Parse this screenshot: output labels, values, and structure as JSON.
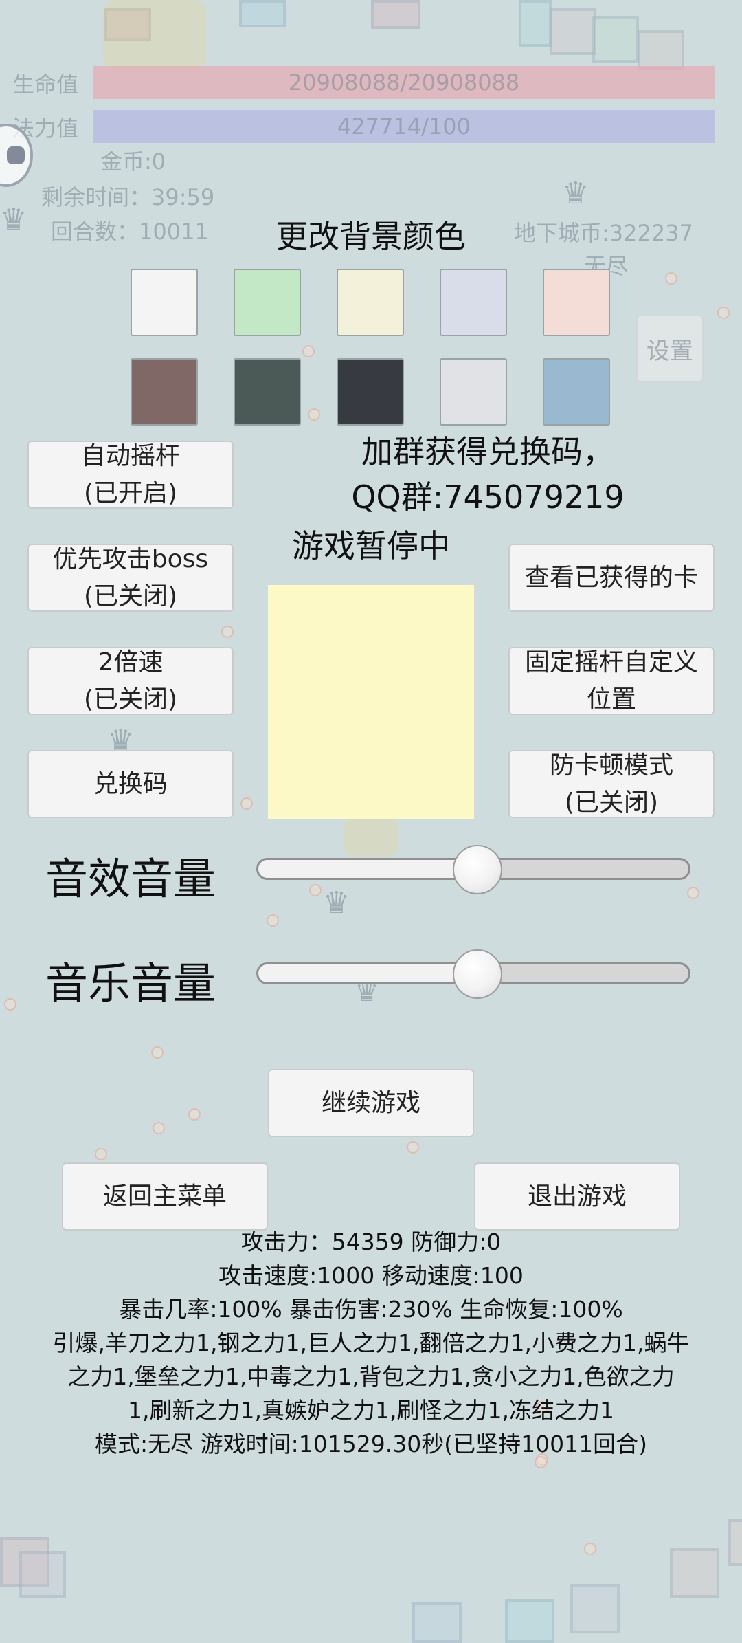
{
  "hud": {
    "hp_label": "生命值",
    "hp_value": "20908088/20908088",
    "mp_label": "法力值",
    "mp_value": "427714/100",
    "gold": "金币:0",
    "time_left": "剩余时间：39:59",
    "rounds": "回合数：10011",
    "dungeon_coins": "地下城币:322237",
    "mode_short": "无尽",
    "settings_label": "设置"
  },
  "bg_color": {
    "title": "更改背景颜色",
    "swatches": [
      "#f4f4f4",
      "#c3e8c6",
      "#f3f1d9",
      "#d8dde9",
      "#f5ddd7",
      "#7f6865",
      "#4c5a57",
      "#373a41",
      "#e1e2e6",
      "#9ab8cf"
    ]
  },
  "promo": {
    "line1": "加群获得兑换码，",
    "line2": "QQ群:745079219"
  },
  "paused_text": "游戏暂停中",
  "left_buttons": [
    {
      "l1": "自动摇杆",
      "l2": "(已开启)"
    },
    {
      "l1": "优先攻击boss",
      "l2": "(已关闭)"
    },
    {
      "l1": "2倍速",
      "l2": "(已关闭)"
    },
    {
      "l1": "兑换码",
      "l2": ""
    }
  ],
  "right_buttons": [
    {
      "l1": "查看已获得的卡",
      "l2": ""
    },
    {
      "l1": "固定摇杆自定义",
      "l2": "位置"
    },
    {
      "l1": "防卡顿模式",
      "l2": "(已关闭)"
    }
  ],
  "sound": {
    "label": "音效音量",
    "value": 0.5
  },
  "music": {
    "label": "音乐音量",
    "value": 0.5
  },
  "actions": {
    "continue": "继续游戏",
    "main_menu": "返回主菜单",
    "quit": "退出游戏"
  },
  "stats": {
    "line1": "攻击力：54359 防御力:0",
    "line2": "攻击速度:1000 移动速度:100",
    "line3": "暴击几率:100% 暴击伤害:230% 生命恢复:100%",
    "line4": "引爆,羊刀之力1,钢之力1,巨人之力1,翻倍之力1,小费之力1,蜗牛",
    "line5": "之力1,堡垒之力1,中毒之力1,背包之力1,贪小之力1,色欲之力",
    "line6": "1,刷新之力1,真嫉妒之力1,刷怪之力1,冻结之力1",
    "line7": "模式:无尽 游戏时间:101529.30秒(已坚持10011回合)"
  }
}
